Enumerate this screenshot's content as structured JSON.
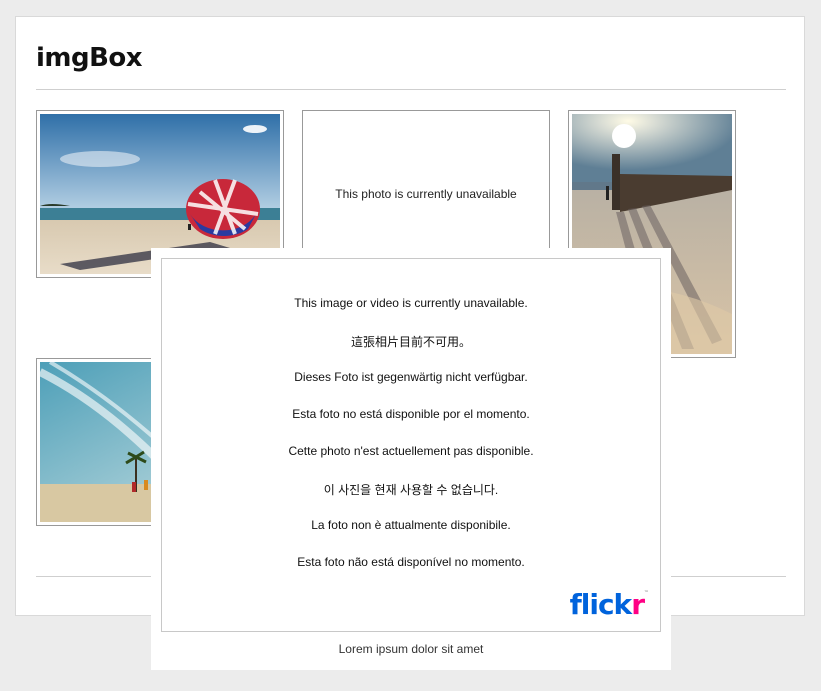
{
  "page": {
    "title": "imgBox"
  },
  "gallery": {
    "thumbs": [
      {
        "name": "beach-parachute-photo"
      },
      {
        "name": "unavailable-photo",
        "text": "This photo is currently unavailable"
      },
      {
        "name": "pier-sunset-photo"
      },
      {
        "name": "palm-beach-photo"
      }
    ]
  },
  "lightbox": {
    "messages": [
      "This image or video is currently unavailable.",
      "這張相片目前不可用。",
      "Dieses Foto ist gegenwärtig nicht verfügbar.",
      "Esta foto no está disponible por el momento.",
      "Cette photo n'est actuellement pas disponible.",
      "이 사진을 현재 사용할 수 없습니다.",
      "La foto non è attualmente disponibile.",
      "Esta foto não está disponível no momento."
    ],
    "logo": {
      "part1": "flick",
      "part2": "r",
      "tm": "™"
    },
    "caption": "Lorem ipsum dolor sit amet"
  },
  "colors": {
    "flickr_blue": "#0063dc",
    "flickr_pink": "#ff0084"
  }
}
